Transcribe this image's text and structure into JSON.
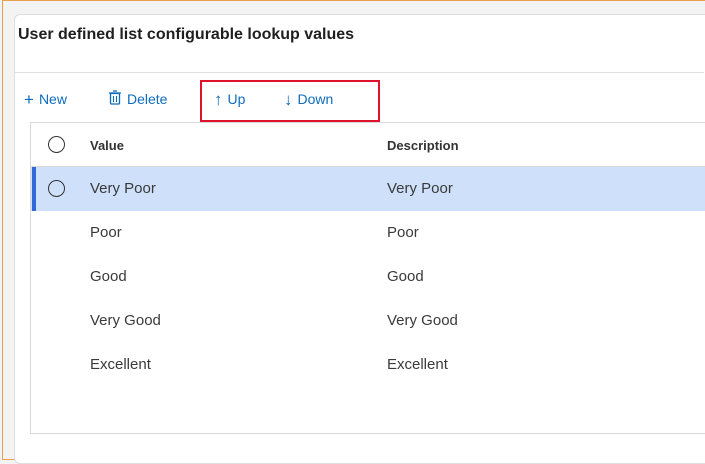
{
  "panel": {
    "title": "User defined list configurable lookup values"
  },
  "toolbar": {
    "new_label": "New",
    "delete_label": "Delete",
    "up_label": "Up",
    "down_label": "Down",
    "icons": {
      "new": "plus-icon",
      "delete": "trash-icon",
      "up": "arrow-up-icon",
      "down": "arrow-down-icon"
    }
  },
  "grid": {
    "columns": [
      "Value",
      "Description"
    ],
    "rows": [
      {
        "value": "Very Poor",
        "description": "Very Poor",
        "selected": true
      },
      {
        "value": "Poor",
        "description": "Poor",
        "selected": false
      },
      {
        "value": "Good",
        "description": "Good",
        "selected": false
      },
      {
        "value": "Very Good",
        "description": "Very Good",
        "selected": false
      },
      {
        "value": "Excellent",
        "description": "Excellent",
        "selected": false
      }
    ]
  },
  "colors": {
    "accent": "#0f6cbd",
    "selected_row": "#cfe0fa",
    "highlight_box": "#e0112b"
  }
}
